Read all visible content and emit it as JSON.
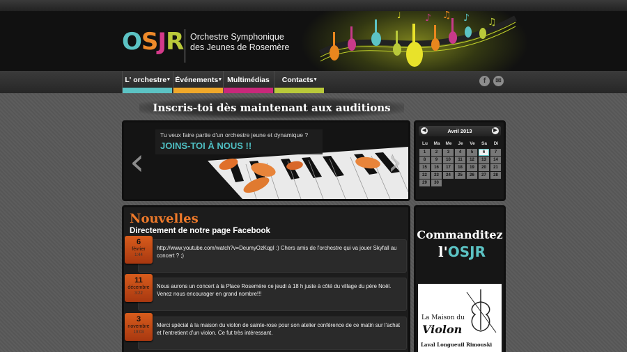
{
  "logo": {
    "letters": [
      "O",
      "S",
      "J",
      "R"
    ],
    "line1": "Orchestre Symphonique",
    "line2": "des Jeunes de Rosemère"
  },
  "nav": {
    "items": [
      {
        "label": "L' orchestre",
        "caret": "▾",
        "color": "#5cc3c4"
      },
      {
        "label": "Événements",
        "caret": "▾",
        "color": "#f0a82a"
      },
      {
        "label": "Multimédias",
        "caret": "",
        "color": "#c8287a"
      },
      {
        "label": "Contacts",
        "caret": "▾",
        "color": "#b9c93a"
      }
    ],
    "social": [
      "facebook-icon",
      "mail-icon"
    ]
  },
  "banner": {
    "text": "Inscris-toi dès maintenant aux auditions"
  },
  "slider": {
    "question": "Tu veux faire partie d'un orchestre jeune et dynamique ?",
    "cta": "JOINS-TOI À NOUS !!",
    "prev": "‹",
    "next": "›"
  },
  "calendar": {
    "month": "Avril 2013",
    "prev": "◀",
    "next": "▶",
    "dow": [
      "Lu",
      "Ma",
      "Me",
      "Je",
      "Ve",
      "Sa",
      "Di"
    ],
    "weeks": [
      [
        "1",
        "2",
        "3",
        "4",
        "5",
        "6",
        "7"
      ],
      [
        "8",
        "9",
        "10",
        "11",
        "12",
        "13",
        "14"
      ],
      [
        "15",
        "16",
        "17",
        "18",
        "19",
        "20",
        "21"
      ],
      [
        "22",
        "23",
        "24",
        "25",
        "26",
        "27",
        "28"
      ],
      [
        "29",
        "30",
        "",
        "",
        "",
        "",
        ""
      ]
    ],
    "today": "6"
  },
  "news": {
    "title": "Nouvelles",
    "subtitle": "Directement de notre page Facebook",
    "posts": [
      {
        "day": "6",
        "month": "février",
        "time": "1:44",
        "text": "http://www.youtube.com/watch?v=DeumyOzKqgI :) Chers amis de l'orchestre qui va jouer Skyfall au concert ? ;)"
      },
      {
        "day": "11",
        "month": "décembre",
        "time": "3:22",
        "text": "Nous aurons un concert à la Place Rosemère ce jeudi à 18 h juste à côté du village du père Noël. Venez nous encourager en grand nombre!!!"
      },
      {
        "day": "3",
        "month": "novembre",
        "time": "19:03",
        "text": "Merci spécial à la maison du violon de sainte-rose pour son atelier conférence de ce matin sur l'achat et l'entretient d'un violon. Ce fut très intéressant."
      }
    ]
  },
  "sponsor": {
    "title": "Commanditez",
    "prefix": "l'",
    "logo": "OSJR",
    "ad_line1": "La Maison du",
    "ad_line2": "Violon",
    "ad_line3": "Laval Longueuil Rimouski"
  }
}
